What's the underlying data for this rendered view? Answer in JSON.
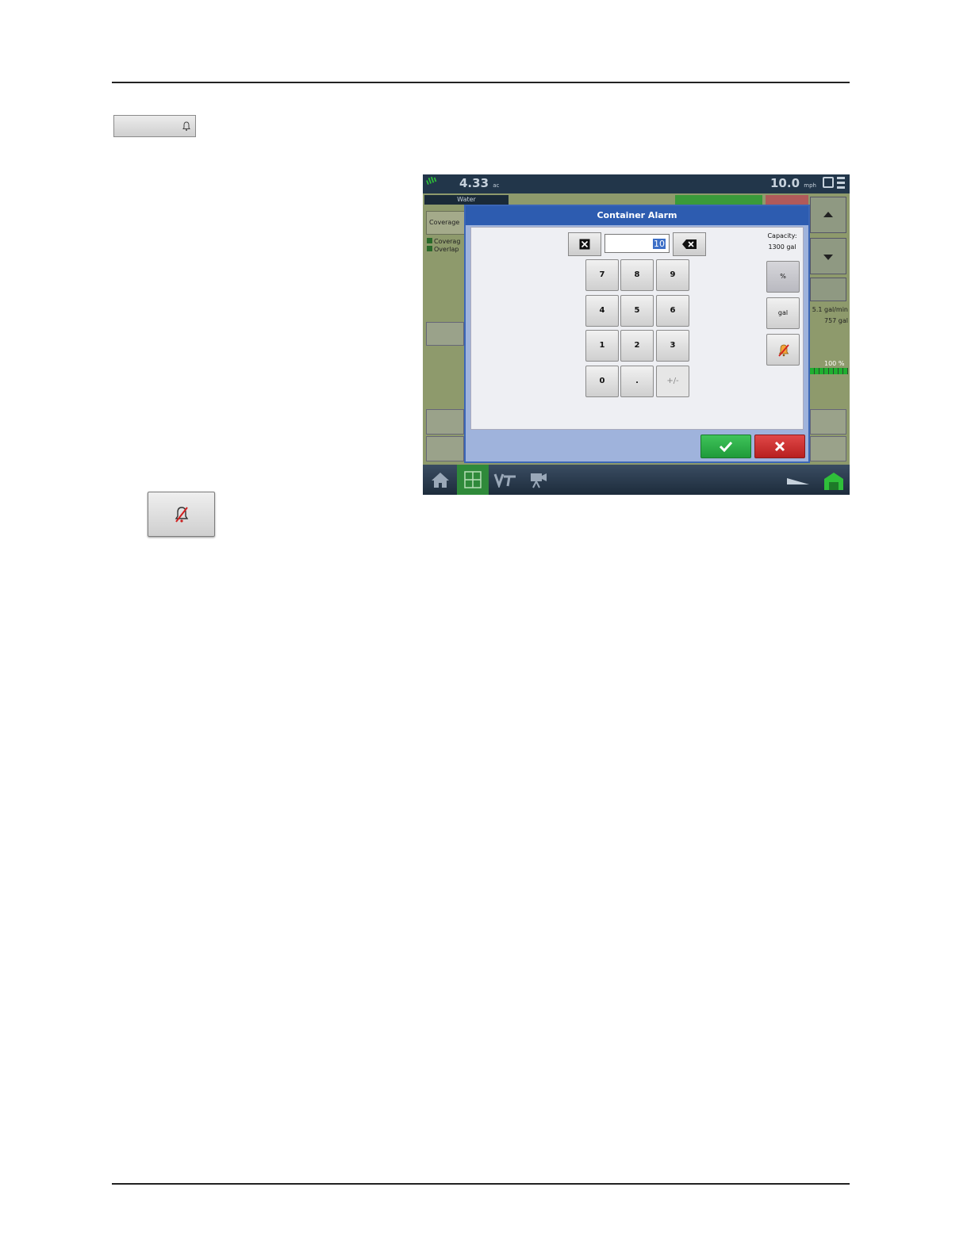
{
  "dialog": {
    "title": "Container Alarm",
    "entry_value": "10",
    "capacity_label": "Capacity:",
    "capacity_value": "1300 gal",
    "keys": [
      "7",
      "8",
      "9",
      "4",
      "5",
      "6",
      "1",
      "2",
      "3",
      "0",
      ".",
      "+/-"
    ],
    "unit_percent": "%",
    "unit_gal": "gal"
  },
  "status": {
    "area": "4.33",
    "area_unit": "ac",
    "speed": "10.0",
    "speed_unit": "mph"
  },
  "background": {
    "water_label": "Water",
    "coverage_label": "Coverage",
    "legend_coverage": "Coverag",
    "legend_overlap": "Overlap",
    "rate": "5.1 gal/min",
    "volume": "757 gal",
    "level_pct": "100 %"
  }
}
